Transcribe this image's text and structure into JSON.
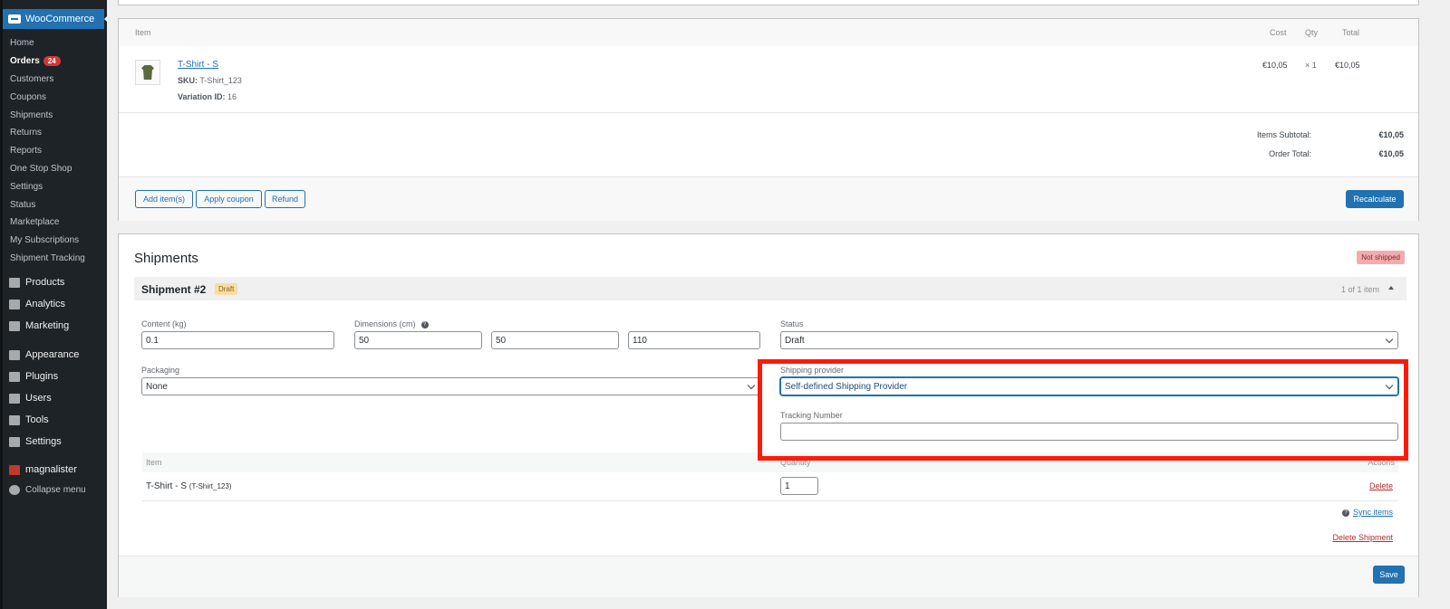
{
  "sidebar": {
    "brand": "WooCommerce",
    "submenu": [
      {
        "label": "Home"
      },
      {
        "label": "Orders",
        "badge": "24"
      },
      {
        "label": "Customers"
      },
      {
        "label": "Coupons"
      },
      {
        "label": "Shipments"
      },
      {
        "label": "Returns"
      },
      {
        "label": "Reports"
      },
      {
        "label": "One Stop Shop"
      },
      {
        "label": "Settings"
      },
      {
        "label": "Status"
      },
      {
        "label": "Marketplace"
      },
      {
        "label": "My Subscriptions"
      },
      {
        "label": "Shipment Tracking"
      }
    ],
    "menu": [
      {
        "label": "Products",
        "icon": "archive-icon"
      },
      {
        "label": "Analytics",
        "icon": "bar-chart-icon"
      },
      {
        "label": "Marketing",
        "icon": "megaphone-icon"
      },
      {
        "label": "Appearance",
        "icon": "paintbrush-icon"
      },
      {
        "label": "Plugins",
        "icon": "plugin-icon"
      },
      {
        "label": "Users",
        "icon": "user-icon"
      },
      {
        "label": "Tools",
        "icon": "wrench-icon"
      },
      {
        "label": "Settings",
        "icon": "settings-icon"
      },
      {
        "label": "magnalister",
        "icon": "magnalister-icon"
      },
      {
        "label": "Collapse menu",
        "icon": "collapse-icon"
      }
    ]
  },
  "items": {
    "headers": {
      "item": "Item",
      "cost": "Cost",
      "qty": "Qty",
      "total": "Total"
    },
    "row": {
      "name": "T-Shirt - S",
      "sku_label": "SKU:",
      "sku": "T-Shirt_123",
      "variation_label": "Variation ID:",
      "variation": "16",
      "cost": "€10,05",
      "qty": "× 1",
      "total": "€10,05"
    },
    "subtotal_label": "Items Subtotal:",
    "subtotal": "€10,05",
    "order_total_label": "Order Total:",
    "order_total": "€10,05",
    "buttons": {
      "add": "Add item(s)",
      "coupon": "Apply coupon",
      "refund": "Refund",
      "recalculate": "Recalculate"
    }
  },
  "shipments": {
    "title": "Shipments",
    "status_badge": "Not shipped",
    "shipment": {
      "name": "Shipment #2",
      "badge": "Draft",
      "count": "1 of 1 item",
      "content_label": "Content (kg)",
      "content_value": "0.1",
      "dimensions_label": "Dimensions (cm)",
      "dim_l": "50",
      "dim_w": "50",
      "dim_h": "110",
      "status_label": "Status",
      "status_value": "Draft",
      "packaging_label": "Packaging",
      "packaging_value": "None",
      "provider_label": "Shipping provider",
      "provider_value": "Self-defined Shipping Provider",
      "tracking_label": "Tracking Number",
      "tracking_value": "",
      "table_headers": {
        "item": "Item",
        "quantity": "Quantity",
        "actions": "Actions"
      },
      "row_name": "T-Shirt - S",
      "row_sku": "(T-Shirt_123)",
      "row_qty": "1",
      "delete": "Delete",
      "sync": "Sync items",
      "delete_shipment": "Delete Shipment"
    },
    "save": "Save"
  },
  "colors": {
    "accent": "#2271b1",
    "sidebar": "#1d2327",
    "highlight": "#ff1a0a",
    "danger": "#b32d2e"
  }
}
